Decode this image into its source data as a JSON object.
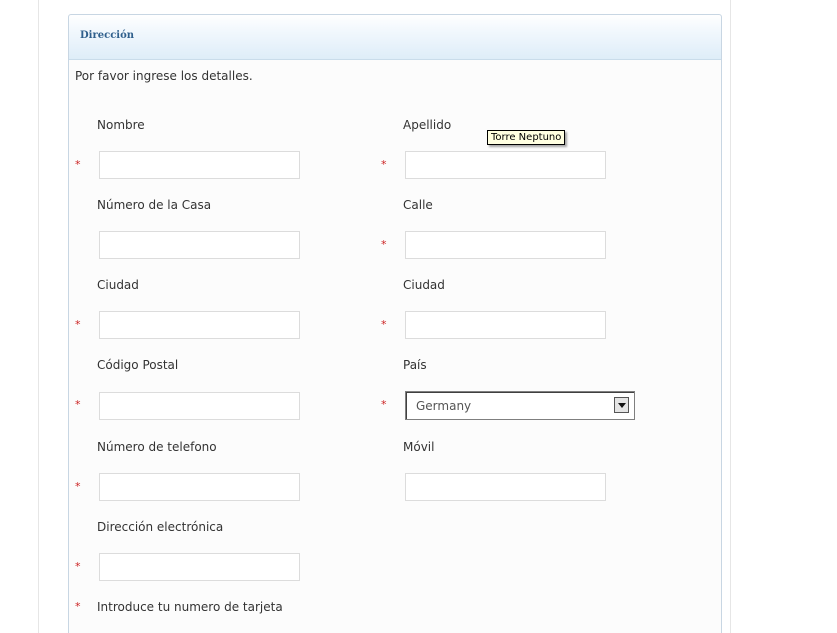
{
  "section": {
    "title": "Dirección",
    "instructions": "Por favor ingrese los detalles."
  },
  "fields": {
    "first_name": {
      "label": "Nombre",
      "value": "",
      "required": "*"
    },
    "last_name": {
      "label": "Apellido",
      "value": "",
      "required": "*"
    },
    "house_number": {
      "label": "Número de la Casa",
      "value": ""
    },
    "street": {
      "label": "Calle",
      "value": "",
      "required": "*"
    },
    "city_1": {
      "label": "Ciudad",
      "value": "",
      "required": "*"
    },
    "city_2": {
      "label": "Ciudad",
      "value": "",
      "required": "*"
    },
    "postal_code": {
      "label": "Código Postal",
      "value": "",
      "required": "*"
    },
    "country": {
      "label": "País",
      "selected": "Germany",
      "required": "*"
    },
    "phone": {
      "label": "Número de telefono",
      "value": "",
      "required": "*"
    },
    "mobile": {
      "label": "Móvil",
      "value": ""
    },
    "email": {
      "label": "Dirección electrónica",
      "value": "",
      "required": "*"
    },
    "card_number": {
      "label": "Introduce tu numero de tarjeta",
      "required": "*"
    }
  },
  "tooltip": {
    "text": "Torre Neptuno"
  },
  "colors": {
    "required_marker": "#cc2222",
    "header_text": "#2f5f8c",
    "panel_border": "#c8d6e3"
  }
}
